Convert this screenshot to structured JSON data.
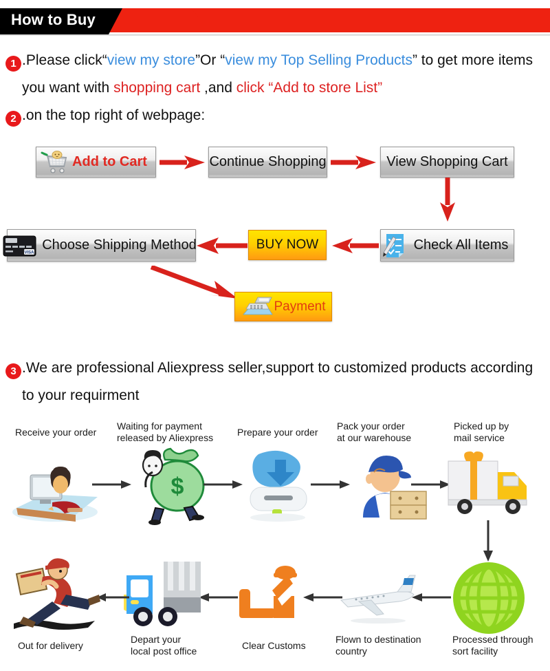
{
  "banner": {
    "title": "How to Buy",
    "black": "#000000",
    "red": "#ee2211"
  },
  "steps": {
    "one": {
      "num": "1",
      "line1_a": ".Please click“",
      "line1_link1": "view my store",
      "line1_b": "”Or “",
      "line1_link2": "view my Top Selling Products",
      "line1_c": "” to get more items",
      "line2_a": "you want with ",
      "line2_red1": "shopping cart",
      "line2_b": " ,and ",
      "line2_red2": "click “Add to store List”"
    },
    "two": {
      "num": "2",
      "text": ".on the top right of webpage:"
    },
    "three": {
      "num": "3",
      "line1": ".We are professional Aliexpress seller,support to customized products according",
      "line2": "to your requirment"
    }
  },
  "flow": {
    "add_to_cart": "Add to Cart",
    "continue_shopping": "Continue Shopping",
    "view_shopping_cart": "View Shopping Cart",
    "check_all_items": "Check All Items",
    "buy_now": "BUY NOW",
    "choose_shipping_method": "Choose Shipping Method",
    "payment": "Payment",
    "arrow_color": "#d8221c"
  },
  "process": {
    "row1": [
      "Receive your order",
      "Waiting for payment\nreleased by Aliexpress",
      "Prepare your order",
      "Pack your order\nat our warehouse",
      "Picked up by\nmail service"
    ],
    "row2": [
      "Out for delivery",
      "Depart your\nlocal post office",
      "Clear Customs",
      "Flown to destination\ncountry",
      "Processed through\nsort facility"
    ],
    "arrow_color": "#333333"
  }
}
